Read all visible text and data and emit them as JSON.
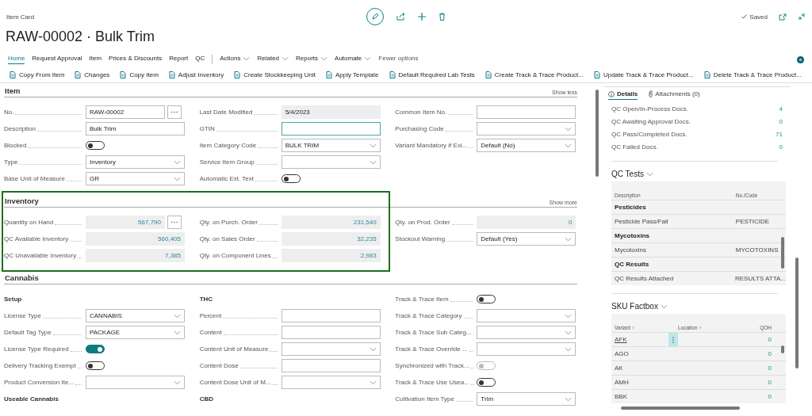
{
  "header": {
    "caption": "Item Card",
    "title": "RAW-00002 · Bulk Trim",
    "status": "Saved"
  },
  "tabs": [
    {
      "label": "Home",
      "kind": "tab",
      "selected": true
    },
    {
      "label": "Request Approval",
      "kind": "tab",
      "selected": false
    },
    {
      "label": "Item",
      "kind": "tab",
      "selected": false
    },
    {
      "label": "Prices & Discounts",
      "kind": "tab",
      "selected": false
    },
    {
      "label": "Report",
      "kind": "tab",
      "selected": false
    },
    {
      "label": "QC",
      "kind": "tab",
      "selected": false
    },
    {
      "label": "Actions",
      "kind": "menu",
      "selected": false
    },
    {
      "label": "Related",
      "kind": "menu",
      "selected": false
    },
    {
      "label": "Reports",
      "kind": "menu",
      "selected": false
    },
    {
      "label": "Automate",
      "kind": "menu",
      "selected": false
    },
    {
      "label": "Fewer options",
      "kind": "link",
      "selected": false
    }
  ],
  "actions": [
    "Copy From Item",
    "Changes",
    "Copy Item",
    "Adjust Inventory",
    "Create Stockkeeping Unit",
    "Apply Template",
    "Default Required Lab Tests",
    "Create Track & Trace Product...",
    "Update Track & Trace Product...",
    "Delete Track & Trace Product..."
  ],
  "sections": [
    {
      "title": "Item",
      "toggle_text": "Show less",
      "highlighted": false,
      "columns": [
        {
          "fields": [
            {
              "label": "No.",
              "kind": "lookup",
              "value": "RAW-00002"
            },
            {
              "label": "Description",
              "kind": "text",
              "value": "Bulk Trim"
            },
            {
              "label": "Blocked",
              "kind": "toggle",
              "on": false,
              "disabled": false
            },
            {
              "label": "Type",
              "kind": "dropdown",
              "value": "Inventory"
            },
            {
              "label": "Base Unit of Measure",
              "kind": "dropdown",
              "value": "GR"
            }
          ]
        },
        {
          "fields": [
            {
              "label": "Last Date Modified",
              "kind": "readonly",
              "value": "5/4/2023"
            },
            {
              "label": "GTIN",
              "kind": "text",
              "focused": true
            },
            {
              "label": "Item Category Code",
              "kind": "dropdown",
              "value": "BULK TRIM"
            },
            {
              "label": "Service Item Group",
              "kind": "dropdown"
            },
            {
              "label": "Automatic Ext. Text",
              "kind": "toggle",
              "on": false,
              "disabled": false
            }
          ]
        },
        {
          "fields": [
            {
              "label": "Common Item No.",
              "kind": "text"
            },
            {
              "label": "Purchasing Code",
              "kind": "dropdown"
            },
            {
              "label": "Variant Mandatory if Exi...",
              "kind": "dropdown",
              "value": "Default (No)"
            }
          ]
        }
      ]
    },
    {
      "title": "Inventory",
      "toggle_text": "Show more",
      "highlighted": true,
      "columns": [
        {
          "fields": [
            {
              "label": "Quantity on Hand",
              "kind": "number-lookup",
              "value": "567,790"
            },
            {
              "label": "QC Available Inventory",
              "kind": "number",
              "value": "560,405"
            },
            {
              "label": "QC Unavailable Inventory",
              "kind": "number",
              "value": "7,385"
            }
          ]
        },
        {
          "fields": [
            {
              "label": "Qty. on Purch. Order",
              "kind": "number",
              "value": "231,540"
            },
            {
              "label": "Qty. on Sales Order",
              "kind": "number",
              "value": "32,235"
            },
            {
              "label": "Qty. on Component Lines",
              "kind": "number",
              "value": "2,983"
            }
          ]
        },
        {
          "fields": [
            {
              "label": "Qty. on Prod. Order",
              "kind": "number",
              "value": "0"
            },
            {
              "label": "Stockout Warning",
              "kind": "dropdown",
              "value": "Default (Yes)"
            }
          ]
        }
      ]
    },
    {
      "title": "Cannabis",
      "highlighted": false,
      "columns": [
        {
          "fields": [
            {
              "label": "Setup",
              "kind": "heading"
            },
            {
              "label": "License Type",
              "kind": "dropdown",
              "value": "CANNABIS"
            },
            {
              "label": "Default Tag Type",
              "kind": "dropdown",
              "value": "PACKAGE"
            },
            {
              "label": "License Type Required",
              "kind": "toggle",
              "on": true,
              "disabled": false
            },
            {
              "label": "Delivery Tracking Exempt",
              "kind": "toggle",
              "on": false,
              "disabled": false
            },
            {
              "label": "Product Conversion Ite...",
              "kind": "dropdown"
            },
            {
              "label": "Useable Cannabis",
              "kind": "heading"
            }
          ]
        },
        {
          "fields": [
            {
              "label": "THC",
              "kind": "heading"
            },
            {
              "label": "Percent",
              "kind": "text"
            },
            {
              "label": "Content",
              "kind": "text"
            },
            {
              "label": "Content Unit of Measure",
              "kind": "dropdown"
            },
            {
              "label": "Content Dose",
              "kind": "text"
            },
            {
              "label": "Content Dose Unit of M...",
              "kind": "dropdown"
            },
            {
              "label": "CBD",
              "kind": "heading"
            }
          ]
        },
        {
          "fields": [
            {
              "label": "Track & Trace Item",
              "kind": "toggle",
              "on": false,
              "disabled": false
            },
            {
              "label": "Track & Trace Category",
              "kind": "dropdown"
            },
            {
              "label": "Track & Trace Sub Categ...",
              "kind": "dropdown"
            },
            {
              "label": "Track & Trace Override ...",
              "kind": "dropdown"
            },
            {
              "label": "Synchronized with Track...",
              "kind": "toggle",
              "on": false,
              "disabled": true
            },
            {
              "label": "Track & Trace Use Usea...",
              "kind": "toggle",
              "on": false,
              "disabled": false
            },
            {
              "label": "Cultivation Item Type",
              "kind": "dropdown",
              "value": "Trim"
            }
          ]
        }
      ]
    }
  ],
  "factbox": {
    "tabs": [
      {
        "label": "Details",
        "selected": true
      },
      {
        "label": "Attachments (0)",
        "selected": false
      }
    ],
    "details": [
      {
        "label": "QC Open/In-Process Docs.",
        "value": "4"
      },
      {
        "label": "QC Awaiting Approval Docs.",
        "value": "0"
      },
      {
        "label": "QC Pass/Completed Docs.",
        "value": "71"
      },
      {
        "label": "QC Failed Docs.",
        "value": "0"
      }
    ],
    "qc_tests": {
      "title": "QC Tests",
      "columns": [
        "Description",
        "No./Code"
      ],
      "rows": [
        {
          "kind": "group",
          "description": "Pesticides"
        },
        {
          "kind": "line",
          "description": "Pesticide Pass/Fail",
          "code": "PESTICIDE"
        },
        {
          "kind": "group",
          "description": "Mycotoxins"
        },
        {
          "kind": "line",
          "description": "Mycotoxins",
          "code": "MYCOTOXINS"
        },
        {
          "kind": "group",
          "description": "QC Results"
        },
        {
          "kind": "line",
          "description": "QC Results Attached",
          "code": "RESULTS ATTA..."
        }
      ]
    },
    "sku": {
      "title": "SKU Factbox",
      "columns": [
        "Variant ↑",
        "Location ↑",
        "QOH"
      ],
      "rows": [
        {
          "variant": "AFK",
          "qoh": "0",
          "selected": true
        },
        {
          "variant": "AGO",
          "qoh": "0",
          "selected": false
        },
        {
          "variant": "AK",
          "qoh": "0",
          "selected": false
        },
        {
          "variant": "AMH",
          "qoh": "0",
          "selected": false
        },
        {
          "variant": "BBK",
          "qoh": "0",
          "selected": false
        }
      ]
    }
  }
}
